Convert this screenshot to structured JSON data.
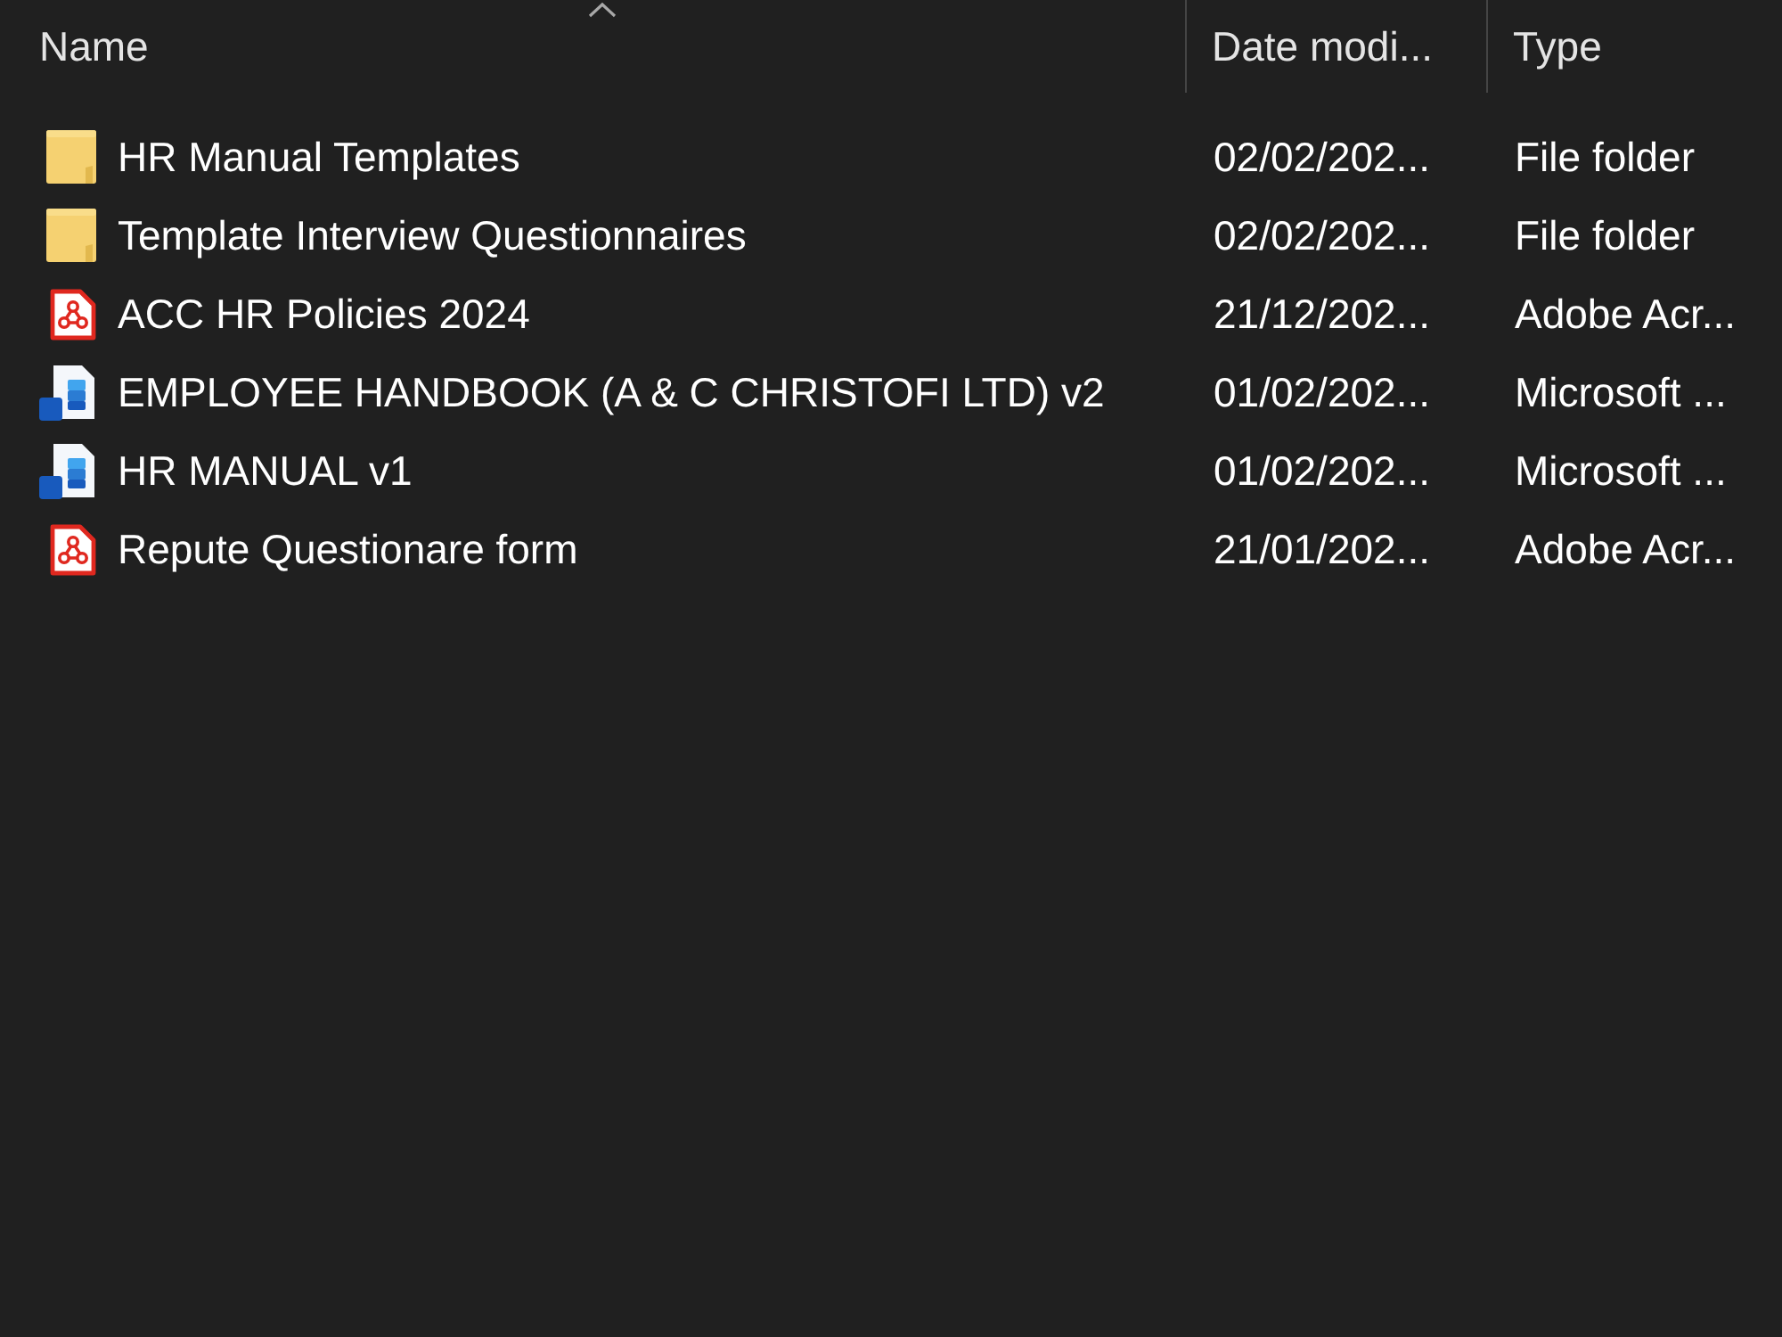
{
  "columns": [
    {
      "label": "Name",
      "sorted": true
    },
    {
      "label": "Date modi...",
      "sorted": false
    },
    {
      "label": "Type",
      "sorted": false
    }
  ],
  "rows": [
    {
      "kind": "folder",
      "name": "HR Manual Templates",
      "date": "02/02/202...",
      "type": "File folder",
      "selected": false
    },
    {
      "kind": "folder",
      "name": "Template Interview Questionnaires",
      "date": "02/02/202...",
      "type": "File folder",
      "selected": false
    },
    {
      "kind": "pdf",
      "name": "ACC HR Policies 2024",
      "date": "21/12/202...",
      "type": "Adobe Acr...",
      "selected": false
    },
    {
      "kind": "word",
      "name": "EMPLOYEE HANDBOOK (A & C CHRISTOFI LTD) v2",
      "date": "01/02/202...",
      "type": "Microsoft ...",
      "selected": false
    },
    {
      "kind": "word",
      "name": "HR MANUAL v1",
      "date": "01/02/202...",
      "type": "Microsoft ...",
      "selected": false
    },
    {
      "kind": "pdf",
      "name": "Repute Questionare form",
      "date": "21/01/202...",
      "type": "Adobe Acr...",
      "selected": false
    }
  ]
}
